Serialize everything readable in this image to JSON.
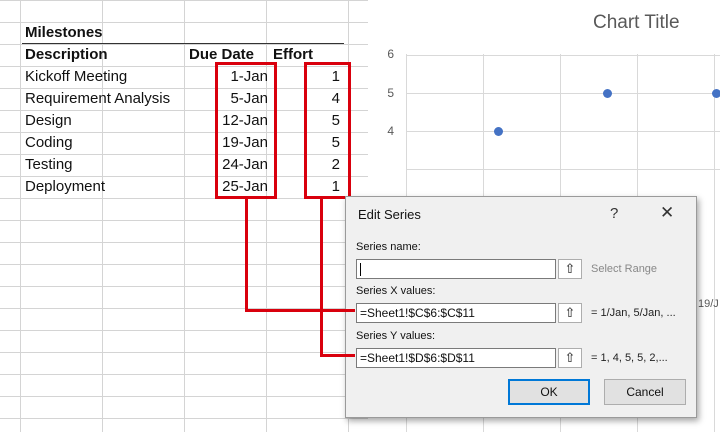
{
  "sheet": {
    "section_title": "Milestones",
    "headers": {
      "description": "Description",
      "due_date": "Due Date",
      "effort": "Effort"
    },
    "rows": [
      {
        "description": "Kickoff Meeting",
        "due_date": "1-Jan",
        "effort": "1"
      },
      {
        "description": "Requirement Analysis",
        "due_date": "5-Jan",
        "effort": "4"
      },
      {
        "description": "Design",
        "due_date": "12-Jan",
        "effort": "5"
      },
      {
        "description": "Coding",
        "due_date": "19-Jan",
        "effort": "5"
      },
      {
        "description": "Testing",
        "due_date": "24-Jan",
        "effort": "2"
      },
      {
        "description": "Deployment",
        "due_date": "25-Jan",
        "effort": "1"
      }
    ]
  },
  "chart": {
    "title": "Chart Title",
    "y_ticks": [
      "6",
      "5",
      "4"
    ],
    "x_tick_partial": "19/J"
  },
  "chart_data": {
    "type": "scatter",
    "title": "Chart Title",
    "ylim": [
      3,
      6
    ],
    "points": [
      {
        "x": "1-Jan",
        "y": 1
      },
      {
        "x": "5-Jan",
        "y": 4
      },
      {
        "x": "12-Jan",
        "y": 5
      },
      {
        "x": "19-Jan",
        "y": 5
      },
      {
        "x": "24-Jan",
        "y": 2
      },
      {
        "x": "25-Jan",
        "y": 1
      }
    ]
  },
  "dialog": {
    "title": "Edit Series",
    "help_glyph": "?",
    "close_glyph": "✕",
    "name_label": "Series name:",
    "name_value": "",
    "select_range": "Select Range",
    "x_label": "Series X values:",
    "x_value": "=Sheet1!$C$6:$C$11",
    "x_preview": "= 1/Jan, 5/Jan, ...",
    "y_label": "Series Y values:",
    "y_value": "=Sheet1!$D$6:$D$11",
    "y_preview": "= 1, 4, 5, 5, 2,...",
    "collapse_glyph": "⇧",
    "ok": "OK",
    "cancel": "Cancel"
  },
  "colors": {
    "accent": "#d9000d",
    "point": "#4472c4",
    "ok_border": "#0078d7"
  }
}
